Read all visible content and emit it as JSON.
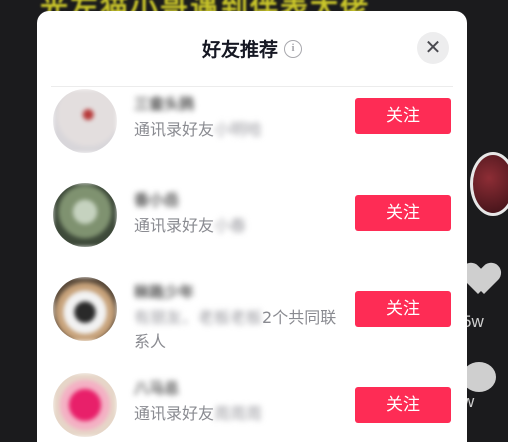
{
  "background": {
    "banner_text": "光左猫小哥遇到伴表大佬",
    "like_count": "5w",
    "comment_count": "w"
  },
  "modal": {
    "title": "好友推荐",
    "info_icon": "info-icon",
    "close_icon": "close-icon",
    "close_glyph": "✕",
    "accent_color": "#fe2c55"
  },
  "friends": [
    {
      "name": "三畲头鸦",
      "subtitle_prefix": "通讯录好友",
      "subtitle_masked": "小明哈",
      "subtitle_suffix": "",
      "button": "关注"
    },
    {
      "name": "香小岳",
      "subtitle_prefix": "通讯录好友",
      "subtitle_masked": "小春",
      "subtitle_suffix": "",
      "button": "关注"
    },
    {
      "name": "秣路少年",
      "subtitle_prefix": "",
      "subtitle_masked": "有朋友、老板老板",
      "subtitle_suffix": "2个共同联系人",
      "button": "关注"
    },
    {
      "name": "八马总",
      "subtitle_prefix": "通讯录好友",
      "subtitle_masked": "周周周",
      "subtitle_suffix": "",
      "button": "关注"
    }
  ]
}
